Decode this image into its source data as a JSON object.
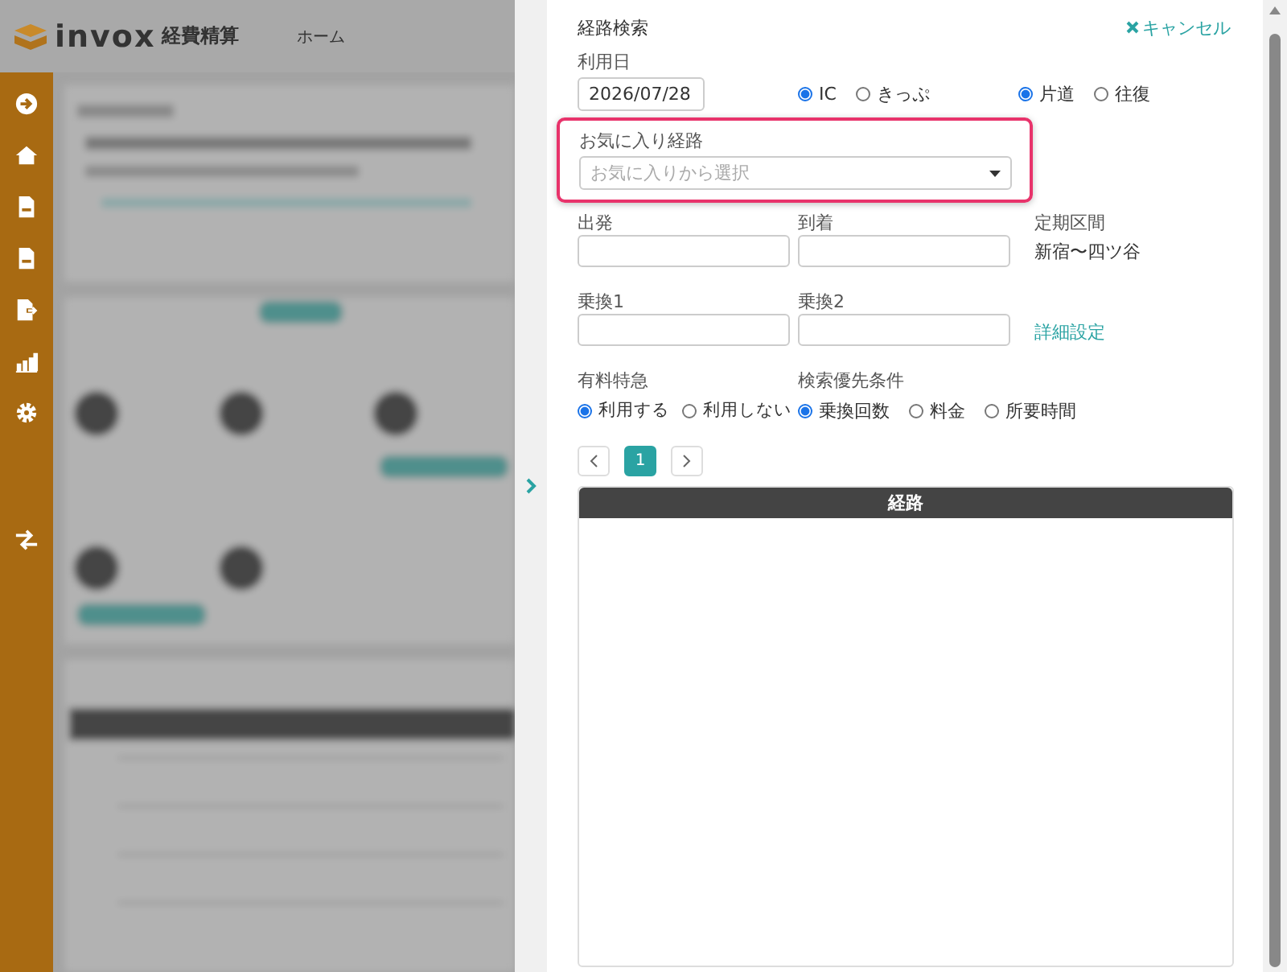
{
  "header": {
    "logo": "invox",
    "logo_sub": "経費精算",
    "nav": "ホーム"
  },
  "sidebar": {
    "items": [
      {
        "kind": "arrow"
      },
      {
        "kind": "home"
      },
      {
        "kind": "doc"
      },
      {
        "kind": "doc"
      },
      {
        "kind": "export"
      },
      {
        "kind": "chart"
      },
      {
        "kind": "gear"
      },
      {
        "kind": "swap"
      }
    ]
  },
  "panel": {
    "title": "経路検索",
    "cancel": "キャンセル",
    "usage_date": {
      "label": "利用日",
      "value": "2026/07/28"
    },
    "ticket_type": [
      {
        "label": "IC",
        "selected": true
      },
      {
        "label": "きっぷ",
        "selected": false
      }
    ],
    "trip_type": [
      {
        "label": "片道",
        "selected": true
      },
      {
        "label": "往復",
        "selected": false
      }
    ],
    "favorite": {
      "label": "お気に入り経路",
      "placeholder": "お気に入りから選択",
      "highlighted": true
    },
    "departure": {
      "label": "出発"
    },
    "arrival": {
      "label": "到着"
    },
    "commuter": {
      "label": "定期区間",
      "value": "新宿〜四ツ谷"
    },
    "transfer1": {
      "label": "乗換1"
    },
    "transfer2": {
      "label": "乗換2"
    },
    "detail_link": "詳細設定",
    "express": {
      "label": "有料特急",
      "options": [
        {
          "label": "利用する",
          "selected": true
        },
        {
          "label": "利用しない",
          "selected": false
        }
      ]
    },
    "priority": {
      "label": "検索優先条件",
      "options": [
        {
          "label": "乗換回数",
          "selected": true
        },
        {
          "label": "料金",
          "selected": false
        },
        {
          "label": "所要時間",
          "selected": false
        }
      ]
    },
    "pagination": {
      "pages": [
        {
          "label": "1",
          "selected": true
        }
      ]
    },
    "table": {
      "columns": [
        "経路"
      ]
    }
  }
}
